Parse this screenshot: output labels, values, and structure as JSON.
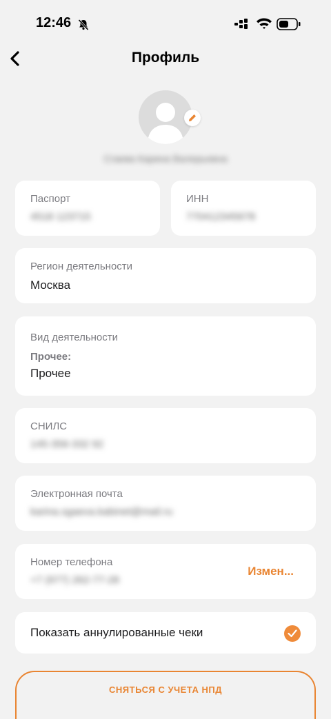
{
  "status": {
    "time": "12:46",
    "icons": [
      "bell-slash-icon",
      "cellular-signal-icon",
      "wifi-icon",
      "battery-icon"
    ]
  },
  "nav": {
    "back_icon": "chevron-left-icon",
    "title": "Профиль"
  },
  "profile": {
    "name": "Сгаева Карина Валерьевна",
    "edit_icon": "pencil-icon"
  },
  "passport": {
    "label": "Паспорт",
    "value": "4518 123715"
  },
  "inn": {
    "label": "ИНН",
    "value": "770412345678"
  },
  "region": {
    "label": "Регион деятельности",
    "value": "Москва"
  },
  "activity": {
    "label": "Вид деятельности",
    "sub_label": "Прочее:",
    "value": "Прочее"
  },
  "snils": {
    "label": "СНИЛС",
    "value": "145-356-332 92"
  },
  "email": {
    "label": "Электронная почта",
    "value": "karina.sgaeva.kabinet@mail.ru"
  },
  "phone": {
    "label": "Номер телефона",
    "value": "+7 (977) 262-77-28",
    "change_label": "Измен..."
  },
  "show_cancelled": {
    "label": "Показать аннулированные чеки",
    "checked": true
  },
  "deregister_button": "СНЯТЬСЯ С УЧЕТА НПД",
  "colors": {
    "accent": "#e98532",
    "background": "#f2f2f2",
    "card": "#ffffff"
  }
}
